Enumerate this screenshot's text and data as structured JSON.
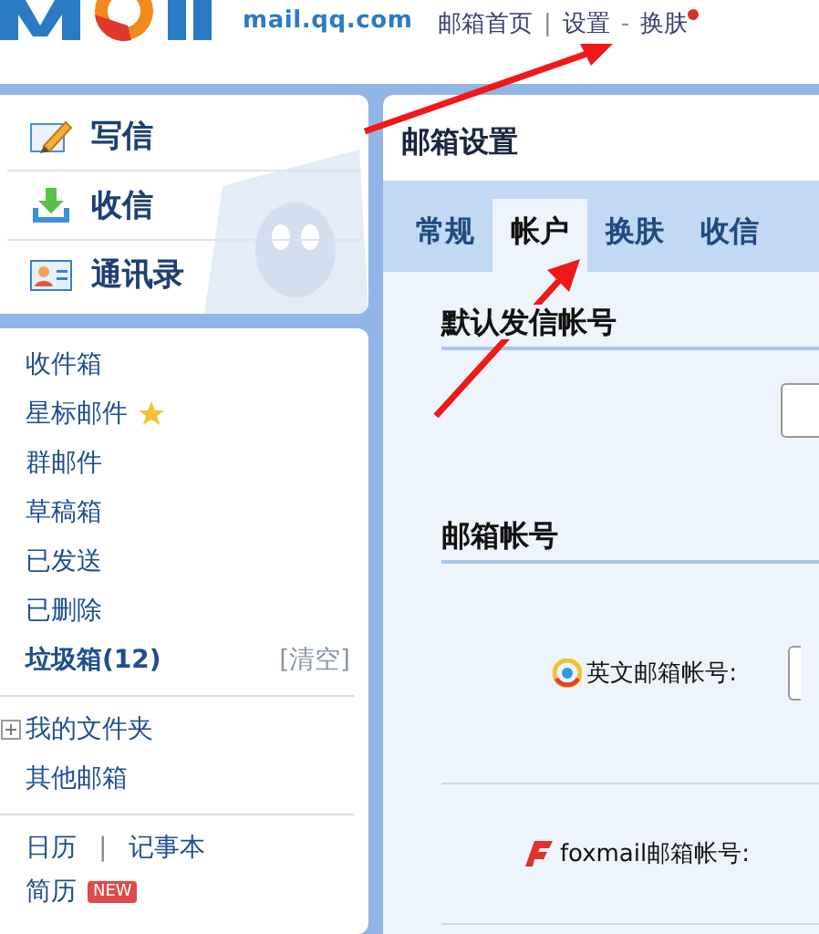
{
  "header": {
    "logo_text": "mail.qq.com",
    "links": [
      {
        "label": "邮箱首页",
        "separator": "|",
        "dot": false
      },
      {
        "label": "设置",
        "separator": "-",
        "dot": false
      },
      {
        "label": "换肤",
        "dot": true
      }
    ]
  },
  "actions": [
    {
      "kind": "write",
      "label": "写信"
    },
    {
      "kind": "receive",
      "label": "收信"
    },
    {
      "kind": "contacts",
      "label": "通讯录"
    }
  ],
  "folders": [
    {
      "label": "收件箱",
      "starred": false,
      "bold": false
    },
    {
      "label": "星标邮件",
      "starred": true,
      "bold": false
    },
    {
      "label": "群邮件",
      "starred": false,
      "bold": false
    },
    {
      "label": "草稿箱",
      "starred": false,
      "bold": false
    },
    {
      "label": "已发送",
      "starred": false,
      "bold": false
    },
    {
      "label": "已删除",
      "starred": false,
      "bold": false
    },
    {
      "label": "垃圾箱(12)",
      "starred": false,
      "bold": true,
      "action": "[清空]"
    }
  ],
  "extra_folders": [
    {
      "label": "我的文件夹",
      "expandable": true
    },
    {
      "label": "其他邮箱",
      "expandable": false
    }
  ],
  "tools": {
    "links": [
      "日历",
      "记事本"
    ],
    "separator": "|",
    "resume": {
      "label": "简历",
      "badge": "NEW"
    }
  },
  "settings": {
    "title": "邮箱设置",
    "tabs": [
      {
        "label": "常规",
        "selected": false
      },
      {
        "label": "帐户",
        "selected": true
      },
      {
        "label": "换肤",
        "selected": false
      },
      {
        "label": "收信",
        "selected": false
      }
    ],
    "sections": [
      {
        "heading": "默认发信帐号",
        "rows": [
          {
            "kind": "select"
          }
        ]
      },
      {
        "heading": "邮箱帐号",
        "rows": [
          {
            "kind": "english",
            "label": "英文邮箱帐号:"
          },
          {
            "kind": "foxmail",
            "label": "foxmail邮箱帐号:"
          }
        ]
      }
    ]
  }
}
